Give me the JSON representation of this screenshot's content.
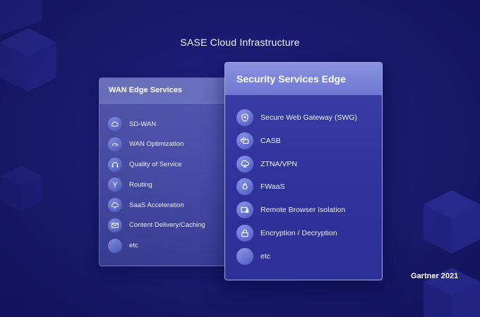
{
  "title": "SASE Cloud Infrastructure",
  "wan_panel": {
    "heading": "WAN Edge Services",
    "items": [
      {
        "label": "SD-WAN",
        "icon": "cloud-icon"
      },
      {
        "label": "WAN Optimization",
        "icon": "speedometer-icon"
      },
      {
        "label": "Quality of Service",
        "icon": "headset-icon"
      },
      {
        "label": "Routing",
        "icon": "routing-fork-icon"
      },
      {
        "label": "SaaS Acceleration",
        "icon": "cloud-gear-icon"
      },
      {
        "label": "Content Delivery/Caching",
        "icon": "envelope-icon"
      },
      {
        "label": "etc",
        "icon": "blank-circle-icon"
      }
    ]
  },
  "sse_panel": {
    "heading": "Security Services Edge",
    "items": [
      {
        "label": "Secure Web Gateway (SWG)",
        "icon": "shield-icon"
      },
      {
        "label": "CASB",
        "icon": "cloud-monitor-icon"
      },
      {
        "label": "ZTNA/VPN",
        "icon": "cloud-network-icon"
      },
      {
        "label": "FWaaS",
        "icon": "flame-icon"
      },
      {
        "label": "Remote Browser Isolation",
        "icon": "browser-lock-icon"
      },
      {
        "label": "Encryption / Decryption",
        "icon": "padlock-icon"
      },
      {
        "label": "etc",
        "icon": "blank-circle-icon"
      }
    ]
  },
  "footer": "Gartner 2021",
  "colors": {
    "background": "#1a1b70",
    "wan_panel": "#6e78cc",
    "sse_header": "#7a83d8",
    "sse_body": "#33379e",
    "icon_circle": "#6a76d4"
  }
}
